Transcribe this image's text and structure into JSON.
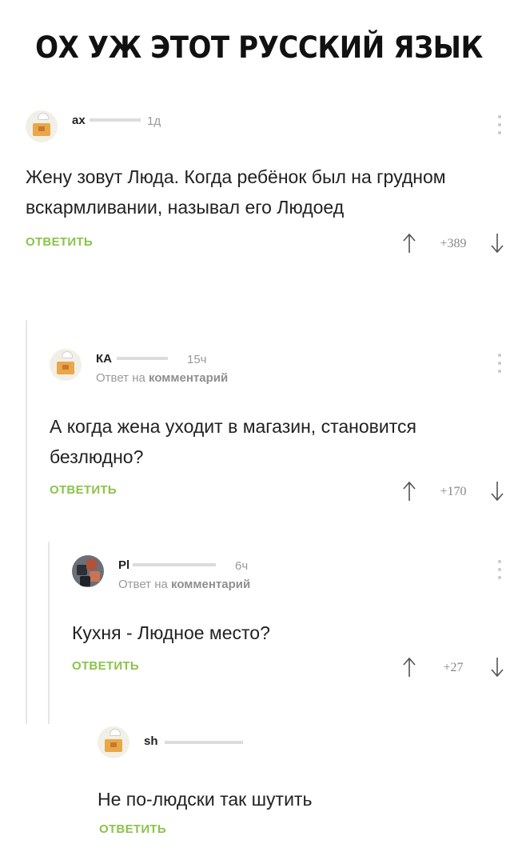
{
  "page_title": "ОХ УЖ ЭТОТ РУССКИЙ ЯЗЫК",
  "comments": [
    {
      "username": "ах",
      "time": "1д",
      "reply_prefix": "",
      "reply_target": "",
      "text": "Жену зовут Люда. Когда ребёнок был на грудном вскармливании, называл его Людоед",
      "reply_label": "ОТВЕТИТЬ",
      "score": "+389",
      "avatar_icon": "cake-avatar-icon"
    },
    {
      "username": "КА",
      "time": "15ч",
      "reply_prefix": "Ответ на",
      "reply_target": "комментарий",
      "text": "А когда жена уходит в магазин, становится безлюдно?",
      "reply_label": "ОТВЕТИТЬ",
      "score": "+170",
      "avatar_icon": "cake-avatar-icon"
    },
    {
      "username": "Pl",
      "time": "6ч",
      "reply_prefix": "Ответ на",
      "reply_target": "комментарий",
      "text": "Кухня - Людное место?",
      "reply_label": "ОТВЕТИТЬ",
      "score": "+27",
      "avatar_icon": "pixel-avatar-icon"
    },
    {
      "username": "sh",
      "time": "",
      "reply_prefix": "",
      "reply_target": "",
      "text": "Не по-людски так шутить",
      "reply_label": "ОТВЕТИТЬ",
      "score": "",
      "avatar_icon": "cake-avatar-icon"
    }
  ],
  "colors": {
    "accent_green": "#8bc34a",
    "muted_text": "#999999",
    "thread_line": "#e6e6e6"
  }
}
